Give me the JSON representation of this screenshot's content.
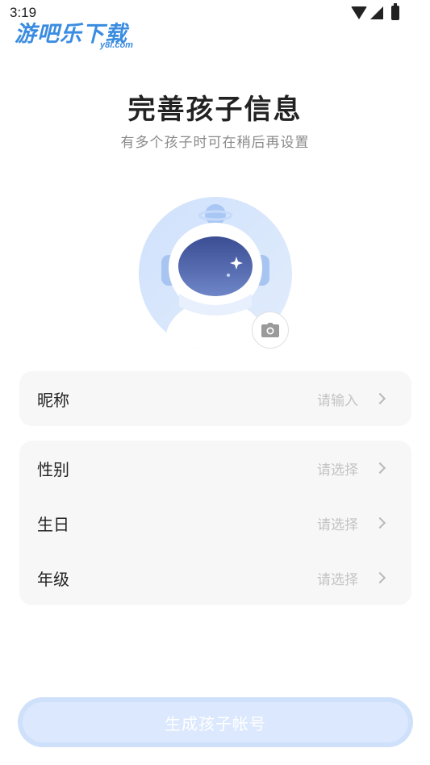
{
  "status_bar": {
    "time": "3:19",
    "icons": [
      "wifi-icon",
      "signal-icon",
      "battery-icon"
    ]
  },
  "watermark": {
    "main": "游吧乐下载",
    "sub": "y8l.com"
  },
  "header": {
    "title": "完善孩子信息",
    "subtitle": "有多个孩子时可在稍后再设置"
  },
  "avatar": {
    "icon": "astronaut-avatar",
    "camera_icon": "camera-icon"
  },
  "form": {
    "nickname": {
      "label": "昵称",
      "placeholder": "请输入"
    },
    "gender": {
      "label": "性别",
      "placeholder": "请选择"
    },
    "birthday": {
      "label": "生日",
      "placeholder": "请选择"
    },
    "grade": {
      "label": "年级",
      "placeholder": "请选择"
    }
  },
  "submit": {
    "label": "生成孩子帐号"
  },
  "colors": {
    "accent_light": "#cfe0fb",
    "avatar_bg": "#d6e6fb",
    "visor": "#4a5fa8"
  }
}
